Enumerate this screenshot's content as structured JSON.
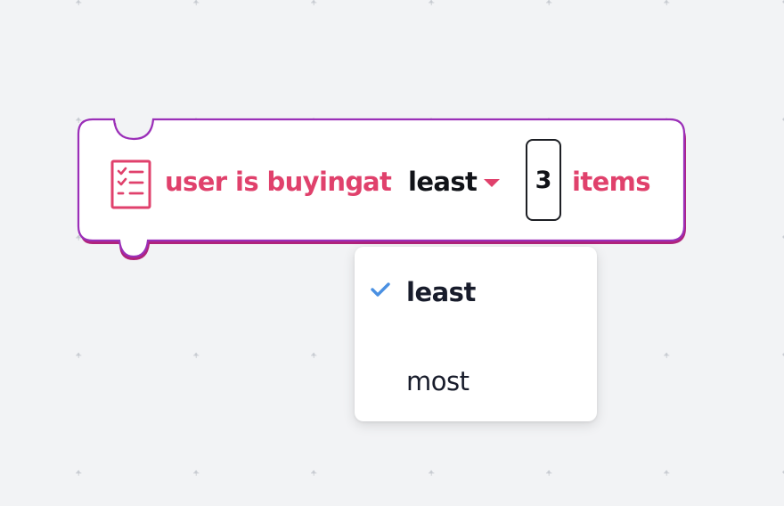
{
  "block": {
    "text_prefix": "user is buying",
    "text_at": "at",
    "dropdown_value": "least",
    "number_value": "3",
    "text_suffix": "items",
    "icon": "checklist-icon"
  },
  "menu": {
    "items": [
      {
        "label": "least",
        "selected": true
      },
      {
        "label": "most",
        "selected": false
      }
    ]
  },
  "colors": {
    "block_outline": "#9b2fb8",
    "accent_text": "#e0416c",
    "check": "#4a90e2",
    "background": "#f2f3f5"
  }
}
